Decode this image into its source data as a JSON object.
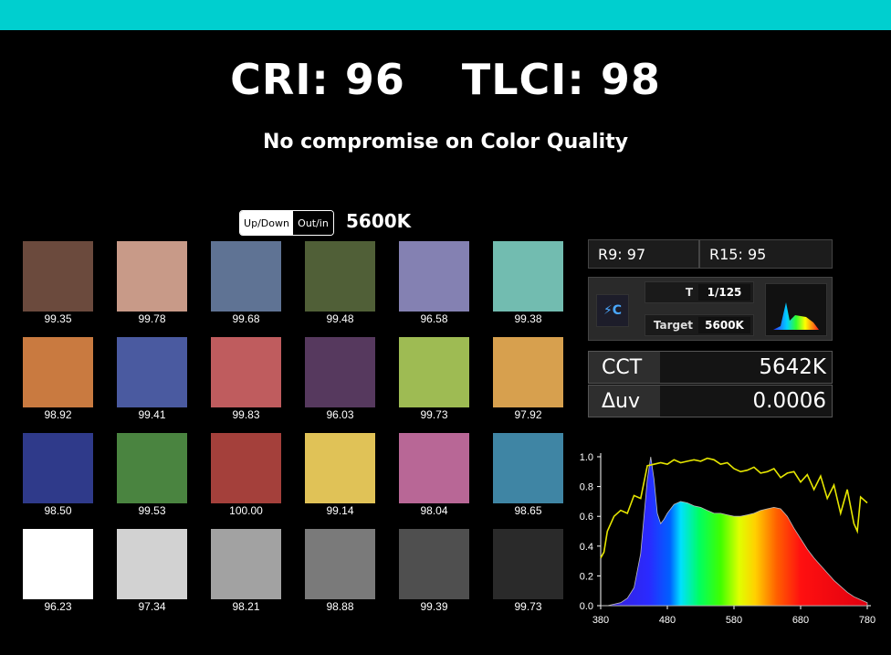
{
  "header": {
    "cri": "CRI: 96",
    "tlci": "TLCI: 98",
    "subtitle": "No compromise on Color Quality"
  },
  "controls": {
    "toggle_option_1": "Up/Down",
    "toggle_option_2": "Out/in",
    "color_temperature": "5600K"
  },
  "swatches": [
    {
      "color": "#6b4a3d",
      "value": "99.35"
    },
    {
      "color": "#c89a88",
      "value": "99.78"
    },
    {
      "color": "#5f7394",
      "value": "99.68"
    },
    {
      "color": "#505f37",
      "value": "99.48"
    },
    {
      "color": "#8481b2",
      "value": "96.58"
    },
    {
      "color": "#72bcb0",
      "value": "99.38"
    },
    {
      "color": "#c97a40",
      "value": "98.92"
    },
    {
      "color": "#4a5aa0",
      "value": "99.41"
    },
    {
      "color": "#bf5c5e",
      "value": "99.83"
    },
    {
      "color": "#56395e",
      "value": "96.03"
    },
    {
      "color": "#9ebb53",
      "value": "99.73"
    },
    {
      "color": "#d7a04e",
      "value": "97.92"
    },
    {
      "color": "#2f3a8a",
      "value": "98.50"
    },
    {
      "color": "#4a8440",
      "value": "99.53"
    },
    {
      "color": "#a4403b",
      "value": "100.00"
    },
    {
      "color": "#e0c257",
      "value": "99.14"
    },
    {
      "color": "#b86796",
      "value": "98.04"
    },
    {
      "color": "#3f85a4",
      "value": "98.65"
    },
    {
      "color": "#ffffff",
      "value": "96.23"
    },
    {
      "color": "#d2d2d2",
      "value": "97.34"
    },
    {
      "color": "#a2a2a2",
      "value": "98.21"
    },
    {
      "color": "#7a7a7a",
      "value": "98.88"
    },
    {
      "color": "#4f4f4f",
      "value": "99.39"
    },
    {
      "color": "#2a2a2a",
      "value": "99.73"
    }
  ],
  "meter": {
    "r9": "R9: 97",
    "r15": "R15: 95",
    "t_label": "T",
    "t_value": "1/125",
    "target_label": "Target",
    "target_value": "5600K",
    "mode_icon": "lightning-c",
    "cct_label": "CCT",
    "cct_value": "5642K",
    "duv_label": "Δuv",
    "duv_value": "0.0006"
  },
  "chart_data": {
    "type": "area",
    "x_ticks": [
      "380",
      "480",
      "580",
      "680",
      "780"
    ],
    "y_ticks": [
      "0.0",
      "0.2",
      "0.4",
      "0.6",
      "0.8",
      "1.0"
    ],
    "xlim": [
      380,
      780
    ],
    "ylim": [
      0,
      1.0
    ],
    "series": [
      {
        "type": "area",
        "x": [
          380,
          390,
          400,
          410,
          420,
          430,
          440,
          450,
          455,
          460,
          465,
          470,
          475,
          480,
          490,
          500,
          510,
          520,
          530,
          540,
          550,
          560,
          570,
          580,
          590,
          600,
          610,
          620,
          630,
          640,
          650,
          660,
          670,
          680,
          690,
          700,
          710,
          720,
          730,
          740,
          750,
          760,
          770,
          780
        ],
        "y": [
          0.0,
          0.0,
          0.01,
          0.02,
          0.05,
          0.12,
          0.35,
          0.85,
          1.0,
          0.85,
          0.62,
          0.55,
          0.58,
          0.62,
          0.68,
          0.7,
          0.69,
          0.67,
          0.66,
          0.64,
          0.62,
          0.62,
          0.61,
          0.6,
          0.6,
          0.61,
          0.62,
          0.64,
          0.65,
          0.66,
          0.65,
          0.6,
          0.52,
          0.45,
          0.38,
          0.32,
          0.27,
          0.22,
          0.17,
          0.13,
          0.09,
          0.06,
          0.04,
          0.02
        ]
      },
      {
        "type": "line",
        "color": "#e6e600",
        "x": [
          380,
          385,
          390,
          400,
          410,
          420,
          430,
          440,
          450,
          460,
          470,
          480,
          490,
          500,
          510,
          520,
          530,
          540,
          550,
          560,
          570,
          580,
          590,
          600,
          610,
          620,
          630,
          640,
          650,
          660,
          670,
          680,
          690,
          700,
          710,
          720,
          730,
          740,
          750,
          760,
          765,
          770,
          775,
          780
        ],
        "y": [
          0.32,
          0.36,
          0.5,
          0.6,
          0.64,
          0.62,
          0.74,
          0.72,
          0.94,
          0.95,
          0.96,
          0.95,
          0.98,
          0.96,
          0.97,
          0.98,
          0.97,
          0.99,
          0.98,
          0.95,
          0.96,
          0.92,
          0.9,
          0.91,
          0.93,
          0.89,
          0.9,
          0.92,
          0.86,
          0.89,
          0.9,
          0.83,
          0.88,
          0.78,
          0.87,
          0.72,
          0.81,
          0.62,
          0.78,
          0.55,
          0.5,
          0.73,
          0.71,
          0.69
        ]
      }
    ]
  }
}
